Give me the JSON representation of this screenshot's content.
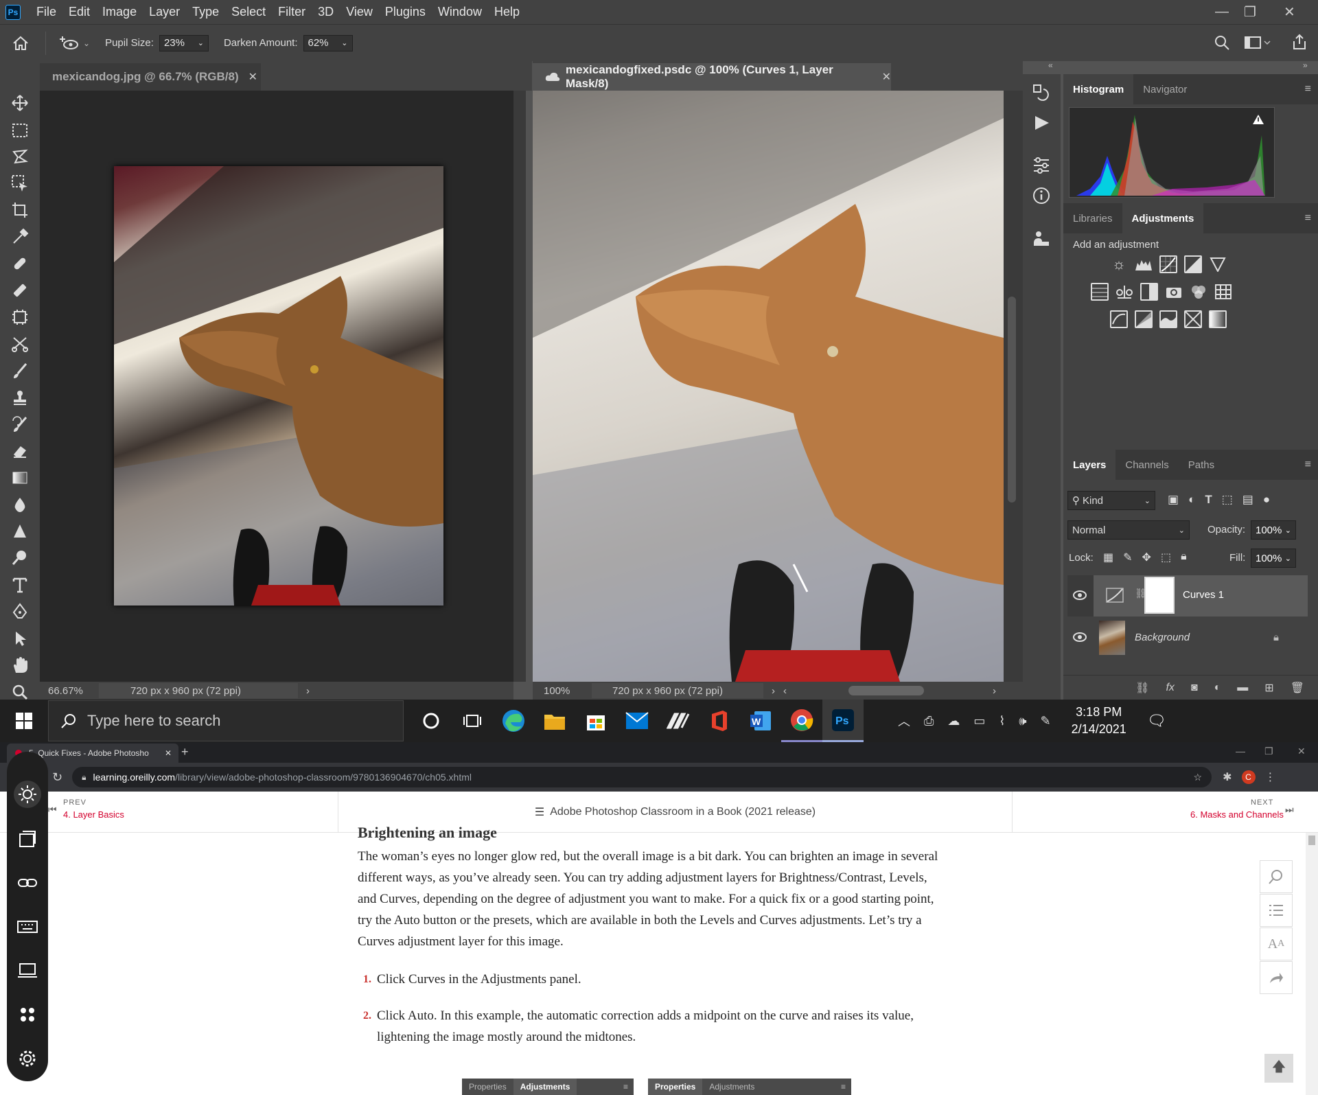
{
  "photoshop": {
    "logo": "Ps",
    "menu": [
      "File",
      "Edit",
      "Image",
      "Layer",
      "Type",
      "Select",
      "Filter",
      "3D",
      "View",
      "Plugins",
      "Window",
      "Help"
    ],
    "options": {
      "pupil_label": "Pupil Size:",
      "pupil_value": "23%",
      "darken_label": "Darken Amount:",
      "darken_value": "62%"
    },
    "docs": [
      {
        "title": "mexicandog.jpg @ 66.7% (RGB/8)",
        "zoom": "66.67%",
        "info": "720 px x 960 px (72 ppi)"
      },
      {
        "title": "mexicandogfixed.psdc @ 100% (Curves 1, Layer Mask/8)",
        "zoom": "100%",
        "info": "720 px x 960 px (72 ppi)"
      }
    ],
    "panels": {
      "top_tabs": [
        "Histogram",
        "Navigator"
      ],
      "mid_tabs": [
        "Libraries",
        "Adjustments"
      ],
      "add_adjustment": "Add an adjustment",
      "layer_tabs": [
        "Layers",
        "Channels",
        "Paths"
      ],
      "kind": "Kind",
      "blend_mode": "Normal",
      "opacity_label": "Opacity:",
      "opacity_value": "100%",
      "lock_label": "Lock:",
      "fill_label": "Fill:",
      "fill_value": "100%",
      "layers": [
        "Curves 1",
        "Background"
      ]
    }
  },
  "taskbar": {
    "search_placeholder": "Type here to search",
    "time": "3:18 PM",
    "date": "2/14/2021"
  },
  "browser": {
    "tab_title": "5. Quick Fixes - Adobe Photosho",
    "url_domain": "learning.oreilly.com",
    "url_path": "/library/view/adobe-photoshop-classroom/9780136904670/ch05.xhtml",
    "prev_label": "PREV",
    "prev_link": "4. Layer Basics",
    "book_title": "Adobe Photoshop Classroom in a Book (2021 release)",
    "next_label": "NEXT",
    "next_link": "6. Masks and Channels",
    "heading": "Brightening an image",
    "paragraph": "The woman’s eyes no longer glow red, but the overall image is a bit dark. You can brighten an image in several different ways, as you’ve already seen. You can try adding adjustment layers for Brightness/Contrast, Levels, and Curves, depending on the degree of adjustment you want to make. For a quick fix or a good starting point, try the Auto button or the presets, which are available in both the Levels and Curves adjustments. Let’s try a Curves adjustment layer for this image.",
    "steps": [
      {
        "num": "1.",
        "text": "Click Curves in the Adjustments panel."
      },
      {
        "num": "2.",
        "text": "Click Auto. In this example, the automatic correction adds a midpoint on the curve and raises its value, lightening the image mostly around the midtones."
      }
    ],
    "fig_tabs": [
      [
        "Properties",
        "Adjustments"
      ],
      [
        "Properties",
        "Adjustments"
      ]
    ]
  },
  "colors": {
    "accent": "#31a8ff",
    "oreilly_red": "#d3002d"
  }
}
